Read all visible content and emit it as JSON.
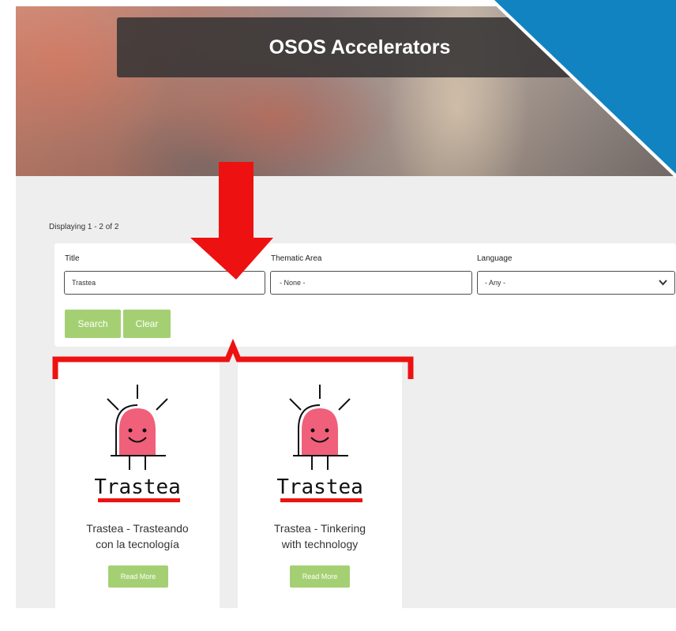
{
  "header": {
    "title": "OSOS Accelerators"
  },
  "results": {
    "count_text": "Displaying 1 - 2 of 2"
  },
  "filters": {
    "title_label": "Title",
    "title_value": "Trastea",
    "thematic_label": "Thematic Area",
    "thematic_value": "- None -",
    "language_label": "Language",
    "language_value": "- Any -",
    "search_label": "Search",
    "clear_label": "Clear"
  },
  "cards": [
    {
      "logo_text": "Trastea",
      "title_line1": "Trastea - Trasteando",
      "title_line2": "con la tecnología",
      "button_label": "Read More"
    },
    {
      "logo_text": "Trastea",
      "title_line1": "Trastea - Tinkering",
      "title_line2": "with technology",
      "button_label": "Read More"
    }
  ],
  "colors": {
    "accent_green": "#a4d073",
    "annotation_red": "#ee1111",
    "corner_blue": "#1183c1",
    "logo_pink": "#f0607a"
  },
  "icons": [
    "chevron-down-icon",
    "trastea-led-logo",
    "down-arrow-annotation",
    "bracket-annotation"
  ]
}
